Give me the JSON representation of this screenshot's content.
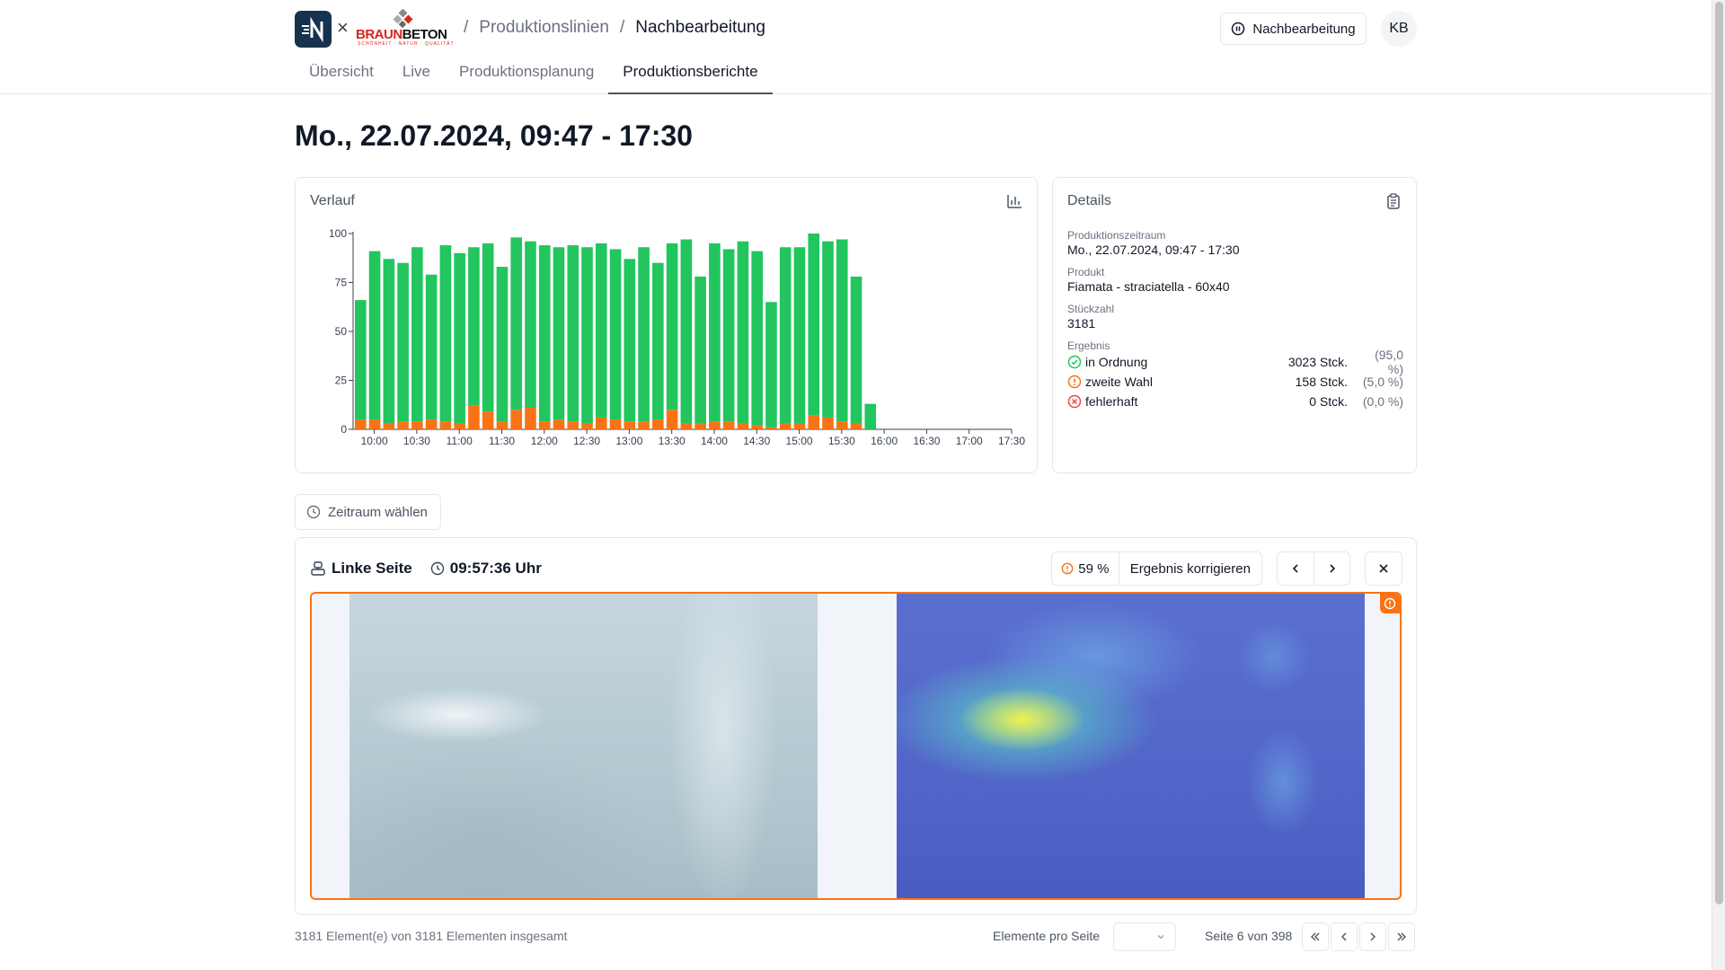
{
  "header": {
    "brand_name_red": "BRAUN",
    "brand_name_black": "BETON",
    "brand_tagline": "SCHÖNHEIT · NATUR · QUALITÄT",
    "breadcrumb": [
      "Produktionslinien",
      "Nachbearbeitung"
    ],
    "mode_button": "Nachbearbeitung",
    "avatar_initials": "KB"
  },
  "tabs": [
    {
      "label": "Übersicht",
      "active": false
    },
    {
      "label": "Live",
      "active": false
    },
    {
      "label": "Produktionsplanung",
      "active": false
    },
    {
      "label": "Produktionsberichte",
      "active": true
    }
  ],
  "page_title": "Mo., 22.07.2024, 09:47 - 17:30",
  "chart_card": {
    "title": "Verlauf",
    "icon": "bar-chart-icon"
  },
  "chart_data": {
    "type": "bar",
    "stacked": true,
    "title": "",
    "xlabel": "",
    "ylabel": "",
    "ylim": [
      0,
      100
    ],
    "y_ticks": [
      "0",
      "25",
      "50",
      "75",
      "100"
    ],
    "x_ticks": [
      "10:00",
      "10:30",
      "11:00",
      "11:30",
      "12:00",
      "12:30",
      "13:00",
      "13:30",
      "14:00",
      "14:30",
      "15:00",
      "15:30",
      "16:00",
      "16:30",
      "17:00",
      "17:30"
    ],
    "x_start_minutes": 585,
    "x_end_minutes": 1050,
    "bar_minutes": 10,
    "series": [
      {
        "color": "#22c55e",
        "values": [
          61,
          86,
          84,
          81,
          89,
          74,
          90,
          87,
          81,
          86,
          79,
          88,
          85,
          90,
          88,
          90,
          90,
          89,
          87,
          83,
          89,
          80,
          85,
          94,
          75,
          91,
          88,
          93,
          89,
          64,
          90,
          90,
          93,
          90,
          93,
          75,
          13
        ]
      },
      {
        "color": "#f97316",
        "values": [
          5,
          5,
          3,
          4,
          4,
          5,
          4,
          3,
          12,
          9,
          4,
          10,
          11,
          4,
          5,
          4,
          3,
          6,
          5,
          4,
          4,
          5,
          10,
          3,
          3,
          4,
          4,
          3,
          2,
          1,
          3,
          3,
          7,
          6,
          4,
          3,
          0
        ]
      }
    ]
  },
  "details": {
    "title": "Details",
    "icon": "clipboard-icon",
    "fields": [
      {
        "label": "Produktionszeitraum",
        "value": "Mo., 22.07.2024, 09:47 - 17:30"
      },
      {
        "label": "Produkt",
        "value": "Fiamata - straciatella - 60x40"
      },
      {
        "label": "Stückzahl",
        "value": "3181"
      }
    ],
    "result_label": "Ergebnis",
    "results": [
      {
        "label": "in Ordnung",
        "count": "3023 Stck.",
        "pct": "(95,0 %)",
        "color": "#22c55e"
      },
      {
        "label": "zweite Wahl",
        "count": "158 Stck.",
        "pct": "(5,0 %)",
        "color": "#f97316"
      },
      {
        "label": "fehlerhaft",
        "count": "0 Stck.",
        "pct": "(0,0 %)",
        "color": "#ef4444"
      }
    ]
  },
  "zeitraum_button": "Zeitraum wählen",
  "inspection": {
    "side": "Linke Seite",
    "time": "09:57:36 Uhr",
    "confidence": "59 %",
    "correct_button": "Ergebnis korrigieren"
  },
  "footer": {
    "summary": "3181 Element(e) von 3181 Elementen insgesamt",
    "per_page_label": "Elemente pro Seite",
    "page_info": "Seite 6 von 398"
  }
}
